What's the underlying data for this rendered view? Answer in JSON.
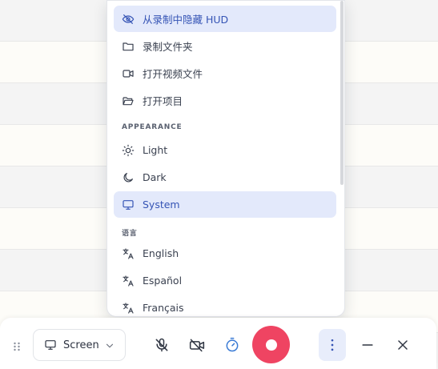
{
  "menu": {
    "items_top": [
      {
        "label": "从录制中隐藏 HUD",
        "icon": "eye-off-icon",
        "active": true
      },
      {
        "label": "录制文件夹",
        "icon": "folder-icon",
        "active": false
      },
      {
        "label": "打开视频文件",
        "icon": "video-icon",
        "active": false
      },
      {
        "label": "打开项目",
        "icon": "folder-open-icon",
        "active": false
      }
    ],
    "appearance_label": "APPEARANCE",
    "appearance_items": [
      {
        "label": "Light",
        "icon": "sun-icon",
        "active": false
      },
      {
        "label": "Dark",
        "icon": "moon-icon",
        "active": false
      },
      {
        "label": "System",
        "icon": "monitor-icon",
        "active": true
      }
    ],
    "language_label": "语言",
    "language_items": [
      {
        "label": "English",
        "icon": "translate-icon"
      },
      {
        "label": "Español",
        "icon": "translate-icon"
      },
      {
        "label": "Français",
        "icon": "translate-icon"
      }
    ]
  },
  "toolbar": {
    "source_label": "Screen",
    "accent": "#3554b5",
    "record_color": "#ef4462"
  }
}
